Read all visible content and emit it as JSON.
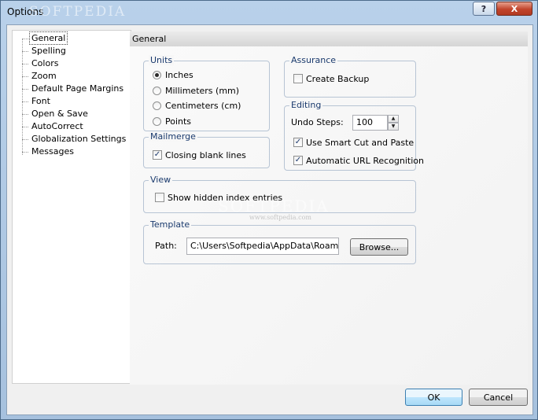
{
  "window": {
    "title": "Options",
    "help_glyph": "?",
    "close_glyph": "X"
  },
  "watermark": {
    "brand": "SOFTPEDIA",
    "url": "www.softpedia.com"
  },
  "tree": {
    "items": [
      {
        "label": "General",
        "selected": true
      },
      {
        "label": "Spelling"
      },
      {
        "label": "Colors"
      },
      {
        "label": "Zoom"
      },
      {
        "label": "Default Page Margins"
      },
      {
        "label": "Font"
      },
      {
        "label": "Open & Save"
      },
      {
        "label": "AutoCorrect"
      },
      {
        "label": "Globalization Settings"
      },
      {
        "label": "Messages"
      }
    ]
  },
  "page": {
    "header": "General",
    "units": {
      "legend": "Units",
      "options": [
        {
          "label": "Inches",
          "checked": true
        },
        {
          "label": "Millimeters (mm)",
          "checked": false
        },
        {
          "label": "Centimeters (cm)",
          "checked": false
        },
        {
          "label": "Points",
          "checked": false
        }
      ]
    },
    "mailmerge": {
      "legend": "Mailmerge",
      "closing_blank_lines": "Closing blank lines",
      "closing_checked": true
    },
    "assurance": {
      "legend": "Assurance",
      "create_backup": "Create Backup",
      "backup_checked": false
    },
    "editing": {
      "legend": "Editing",
      "undo_label": "Undo Steps:",
      "undo_value": "100",
      "smart_cut": "Use Smart Cut and Paste",
      "smart_cut_checked": true,
      "url_recognition": "Automatic URL Recognition",
      "url_checked": true
    },
    "view": {
      "legend": "View",
      "show_hidden": "Show hidden index entries",
      "show_hidden_checked": false
    },
    "template": {
      "legend": "Template",
      "path_label": "Path:",
      "path_value": "C:\\Users\\Softpedia\\AppData\\Roaming\\",
      "browse_label": "Browse..."
    }
  },
  "footer": {
    "ok_label": "OK",
    "cancel_label": "Cancel"
  },
  "glyphs": {
    "check": "✓",
    "up": "▲",
    "down": "▼"
  }
}
